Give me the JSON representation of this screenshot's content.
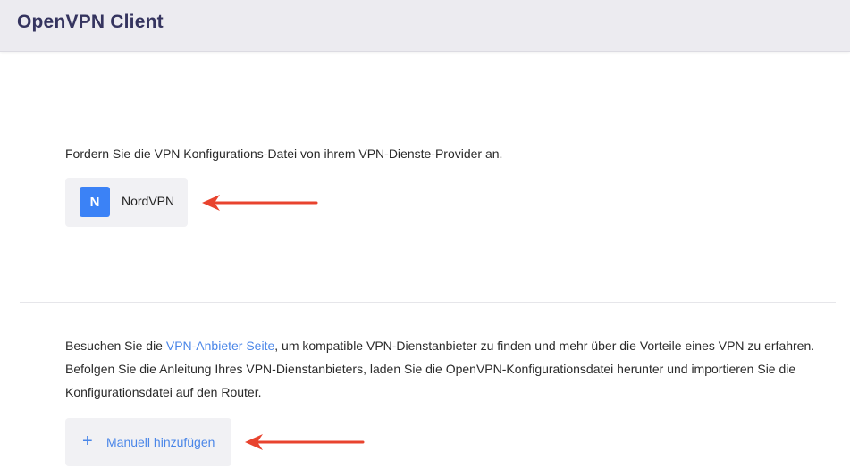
{
  "header": {
    "title": "OpenVPN Client"
  },
  "intro": {
    "text": "Fordern Sie die VPN Konfigurations-Datei von ihrem VPN-Dienste-Provider an."
  },
  "provider": {
    "logo_letter": "N",
    "name": "NordVPN",
    "logo_color": "#3b82f6"
  },
  "info": {
    "line1_before": "Besuchen Sie die ",
    "line1_link": "VPN-Anbieter Seite",
    "line1_after": ", um kompatible VPN-Dienstanbieter zu finden und mehr über die Vorteile eines VPN zu erfahren.",
    "line2": "Befolgen Sie die Anleitung Ihres VPN-Dienstanbieters, laden Sie die OpenVPN-Konfigurationsdatei herunter und importieren Sie die",
    "line3": "Konfigurationsdatei auf den Router."
  },
  "manual_add": {
    "icon": "plus-icon",
    "label": "Manuell hinzufügen"
  },
  "colors": {
    "accent": "#4a86e8",
    "annotation_arrow": "#e8432e",
    "header_bg": "#ecebf0",
    "title": "#35345f"
  }
}
